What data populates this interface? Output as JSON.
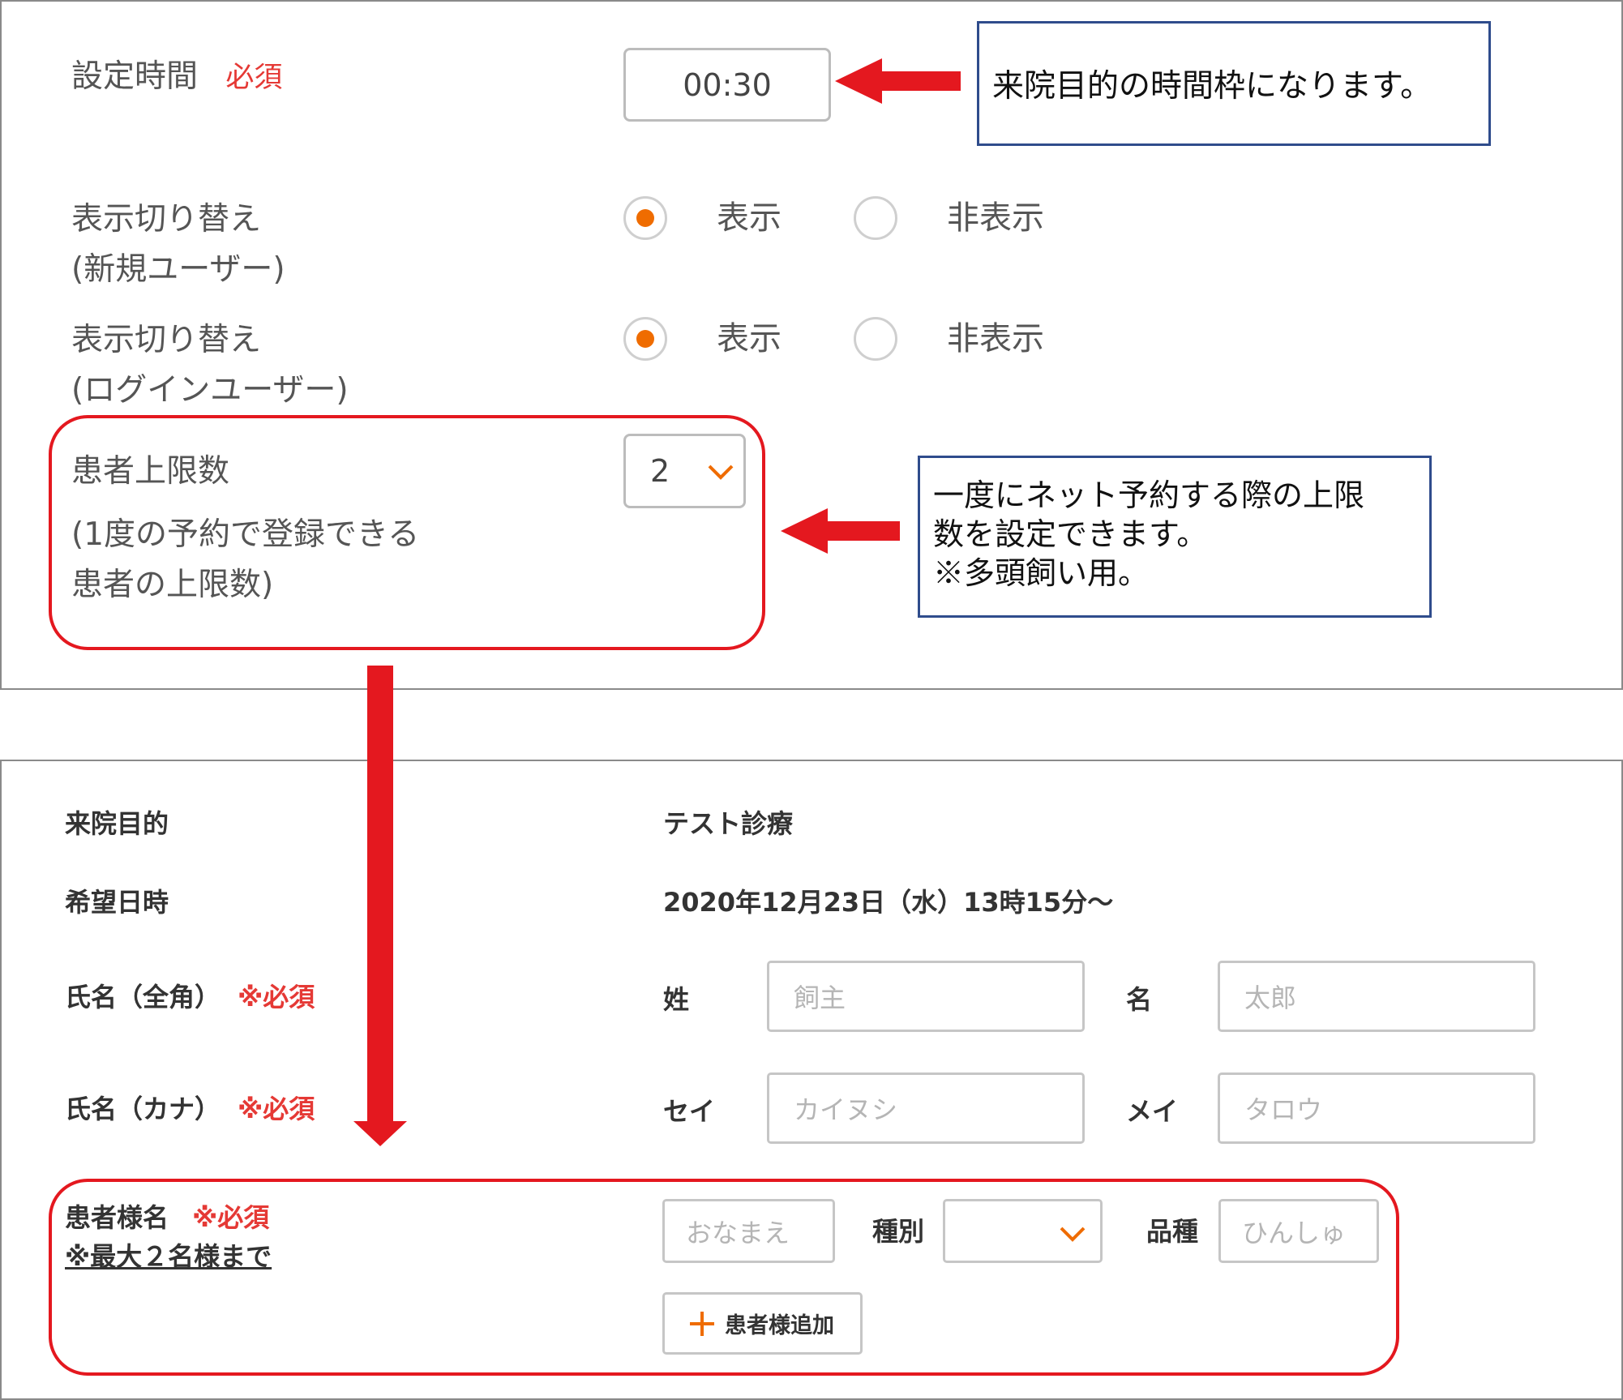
{
  "settings": {
    "time_label": "設定時間",
    "required": "必須",
    "time_value": "00:30",
    "display_new_label": [
      "表示切り替え",
      "(新規ユーザー)"
    ],
    "display_login_label": [
      "表示切り替え",
      "(ログインユーザー)"
    ],
    "show": "表示",
    "hide": "非表示",
    "patient_limit_label": [
      "患者上限数",
      "(1度の予約で登録できる",
      "患者の上限数)"
    ],
    "patient_limit_value": "2"
  },
  "callouts": {
    "time_frame": "来院目的の時間枠になります。",
    "limit": [
      "一度にネット予約する際の上限",
      "数を設定できます。",
      "※多頭飼い用。"
    ]
  },
  "form": {
    "purpose_label": "来院目的",
    "purpose_value": "テスト診療",
    "datetime_label": "希望日時",
    "datetime_value": "2020年12月23日（水）13時15分〜",
    "name_full_label": "氏名（全角）",
    "name_kana_label": "氏名（カナ）",
    "required_mark": "※必須",
    "last_name_label": "姓",
    "last_name_placeholder": "飼主",
    "first_name_label": "名",
    "first_name_placeholder": "太郎",
    "last_kana_label": "セイ",
    "last_kana_placeholder": "カイヌシ",
    "first_kana_label": "メイ",
    "first_kana_placeholder": "タロウ",
    "patient_label": "患者様名",
    "patient_max_note": "※最大２名様まで",
    "patient_name_placeholder": "おなまえ",
    "species_label": "種別",
    "breed_label": "品種",
    "breed_placeholder": "ひんしゅ",
    "add_patient_label": "患者様追加"
  },
  "colors": {
    "accent_orange": "#ef6c00",
    "required_red": "#e53935",
    "annotation_red": "#e4181f",
    "callout_border": "#2f4c8c"
  }
}
